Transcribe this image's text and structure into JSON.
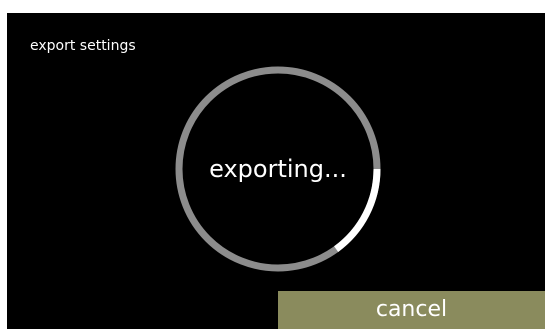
{
  "header": {
    "title": "export settings"
  },
  "progress": {
    "label": "exporting...",
    "fraction": 0.15,
    "track_color": "#8c8c8c",
    "fill_color": "#ffffff"
  },
  "actions": {
    "cancel_label": "cancel",
    "cancel_color": "#8a8b5d"
  },
  "colors": {
    "screen_background": "#000000",
    "text": "#ffffff"
  }
}
